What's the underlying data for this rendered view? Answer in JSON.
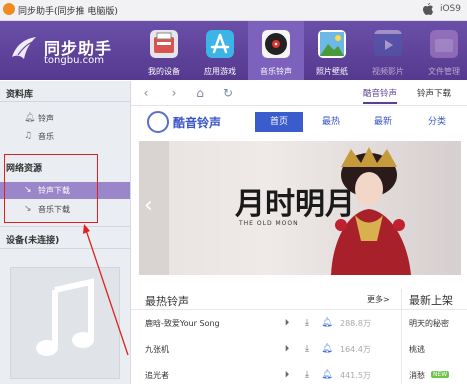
{
  "window": {
    "title": "同步助手(同步推 电脑版)",
    "device": "iOS9"
  },
  "brand": {
    "name": "同步助手",
    "domain": "tongbu.com"
  },
  "nav": [
    {
      "label": "我的设备",
      "icon": "device-icon",
      "color": "#d9534f"
    },
    {
      "label": "应用游戏",
      "icon": "app-store-icon",
      "color": "#3cb4e6"
    },
    {
      "label": "音乐铃声",
      "icon": "music-disc-icon",
      "color": "#222222"
    },
    {
      "label": "照片壁纸",
      "icon": "photo-icon",
      "color": "#4fa3d6"
    },
    {
      "label": "视频影片",
      "icon": "video-icon",
      "color": "#4a5fb0"
    },
    {
      "label": "文件管理",
      "icon": "folder-icon",
      "color": "#c99ad6"
    }
  ],
  "sidebar": {
    "library_title": "资料库",
    "library_items": [
      {
        "label": "铃声",
        "icon": "bell-icon"
      },
      {
        "label": "音乐",
        "icon": "music-note-icon"
      }
    ],
    "network_title": "网络资源",
    "network_items": [
      {
        "label": "铃声下载",
        "icon": "download-icon"
      },
      {
        "label": "音乐下载",
        "icon": "download-icon"
      }
    ],
    "device_title": "设备(未连接)"
  },
  "toolbar": {
    "tabs": [
      "酷音铃声",
      "铃声下载"
    ]
  },
  "kugou": {
    "name": "酷音铃声",
    "tabs": [
      "首页",
      "最热",
      "最新",
      "分类"
    ]
  },
  "banner": {
    "headline": "月时明月",
    "subtitle": "THE OLD MOON"
  },
  "hot": {
    "title": "最热铃声",
    "more": "更多>",
    "songs": [
      {
        "name": "鹿晗-致爱Your Song",
        "size": "288.8万"
      },
      {
        "name": "九张机",
        "size": "164.4万"
      },
      {
        "name": "追光者",
        "size": "441.5万"
      }
    ]
  },
  "new": {
    "title": "最新上架",
    "songs": [
      "明天的秘密",
      "桃逃",
      "消愁"
    ],
    "badge": "NEW"
  },
  "colors": {
    "header": "#5d3f98",
    "accent": "#3b5ccc",
    "annotation": "#e02020"
  }
}
